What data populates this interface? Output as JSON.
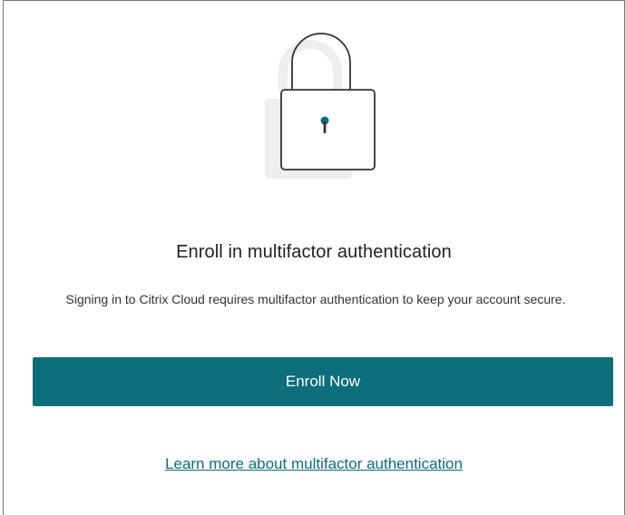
{
  "heading": {
    "title": "Enroll in multifactor authentication",
    "description": "Signing in to Citrix Cloud requires multifactor authentication to keep your account secure."
  },
  "actions": {
    "enroll_label": "Enroll Now",
    "learn_more_label": "Learn more about multifactor authentication"
  },
  "illustration": {
    "icon": "lock-icon"
  },
  "colors": {
    "accent": "#0b6e7a",
    "button_text": "#ffffff",
    "illustration_shadow": "#eeeeee"
  }
}
